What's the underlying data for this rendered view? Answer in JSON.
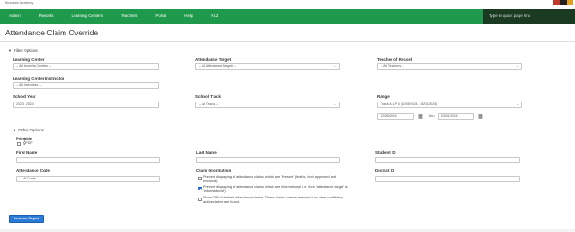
{
  "brand": "Wisconsin Academy",
  "nav": [
    "Admin",
    "Reports",
    "Learning Centers",
    "Teachers",
    "Portal",
    "Help",
    "K12"
  ],
  "quick_find": "Type to quick page find",
  "page_title": "Attendance Claim Override",
  "filter_options": "Filter Options",
  "other_options": "Other Options",
  "fields": {
    "learning_center": {
      "label": "Learning Center",
      "value": "-- All Learning Centers --"
    },
    "attendance_target": {
      "label": "Attendance Target",
      "value": "-- All Attendance Targets --"
    },
    "teacher_of_record": {
      "label": "Teacher of Record",
      "value": "-- All Teachers --"
    },
    "lc_instructor": {
      "label": "Learning Center Instructor",
      "value": "-- All Instructors --"
    },
    "school_year": {
      "label": "School Year",
      "value": "2023 - 2024"
    },
    "school_track": {
      "label": "School Track",
      "value": "-- All Tracks --"
    },
    "range": {
      "label": "Range",
      "value": "Track A: LP 6 (02/05/2024 - 03/01/2024)"
    },
    "date_from": "02/05/2024",
    "date_to": "03/01/2024",
    "thru": "thru",
    "printable": "Printable",
    "pdf": "PDF",
    "first_name": "First Name",
    "last_name": "Last Name",
    "student_id": "Student ID",
    "attendance_code": {
      "label": "Attendance Code",
      "value": "-- All Codes --"
    },
    "claim_information": "Claim Information",
    "district_id": "District ID"
  },
  "claim_options": [
    {
      "text": "Prevent displaying of attendance claims which are 'Present' (that is, both approved and excused).",
      "checked": false
    },
    {
      "text": "Prevent displaying of attendance claims which are informational (i.e. their 'attendance target' is 'Informational')",
      "checked": true
    },
    {
      "text": "Show ONLY deleted attendance claims. These claims can be restored if no other conflicting active claims are found.",
      "checked": false
    }
  ],
  "generate_button": "Generate Report",
  "colors": {
    "nav_green": "#1f9a4d",
    "button_blue": "#2a7ad6",
    "quickfind_dark": "#1a3a22"
  }
}
